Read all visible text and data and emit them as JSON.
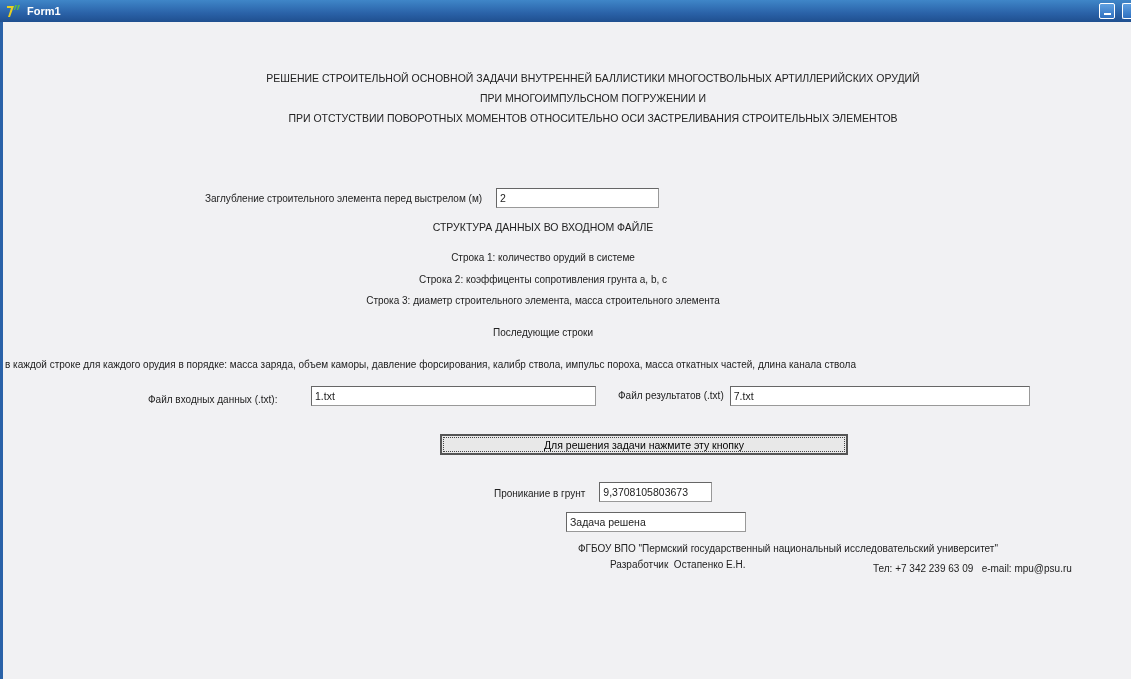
{
  "window": {
    "title": "Form1"
  },
  "heading": [
    "РЕШЕНИЕ СТРОИТЕЛЬНОЙ ОСНОВНОЙ ЗАДАЧИ ВНУТРЕННЕЙ БАЛЛИСТИКИ МНОГОСТВОЛЬНЫХ  АРТИЛЛЕРИЙСКИХ ОРУДИЙ",
    "ПРИ МНОГОИМПУЛЬСНОМ ПОГРУЖЕНИИ И",
    "ПРИ ОТСТУСТВИИ ПОВОРОТНЫХ МОМЕНТОВ ОТНОСИТЕЛЬНО ОСИ ЗАСТРЕЛИВАНИЯ СТРОИТЕЛЬНЫХ ЭЛЕМЕНТОВ"
  ],
  "depth": {
    "label": "Заглубление строительного элемента перед выстрелом (м)",
    "value": "2"
  },
  "structure": {
    "title": "СТРУКТУРА ДАННЫХ ВО ВХОДНОМ ФАЙЛЕ",
    "lines": [
      "Строка 1: количество орудий в системе",
      "Строка 2: коэффиценты сопротивления грунта a, b, c",
      "Строка 3: диаметр строительного элемента, масса строительного элемента"
    ],
    "subtitle": "Последующие строки",
    "detail": "в каждой строке для каждого орудия в порядке: масса заряда, объем каморы, давление форсирования, калибр ствола, импульс пороха, масса откатных частей, длина канала ствола"
  },
  "input_file": {
    "label": "Файл входных данных (.txt):",
    "value": "1.txt"
  },
  "output_file": {
    "label": "Файл результатов (.txt)",
    "value": "7.txt"
  },
  "solve_button": {
    "label": "Для решения задачи нажмите эту кнопку",
    "focused": true
  },
  "penetration": {
    "label": "Проникание в грунт",
    "value": "9,3708105803673"
  },
  "status": {
    "value": "Задача решена"
  },
  "footer": {
    "organization": "ФГБОУ ВПО \"Пермский государственный национальный исследовательский университет\"",
    "developer": "Разработчик  Остапенко Е.Н.",
    "contact": "Тел: +7 342 239 63 09   e-mail: mpu@psu.ru"
  }
}
